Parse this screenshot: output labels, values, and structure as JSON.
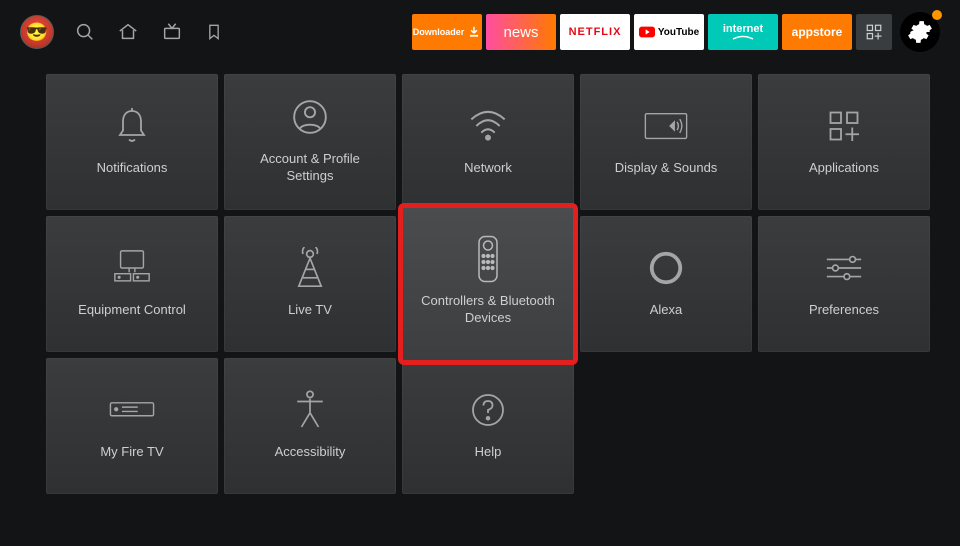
{
  "nav": {
    "search": "search",
    "home": "home",
    "live": "live",
    "bookmark": "bookmark"
  },
  "apps": {
    "downloader": "Downloader",
    "news": "news",
    "netflix": "NETFLIX",
    "youtube": "YouTube",
    "internet": "internet",
    "appstore": "appstore"
  },
  "tiles": [
    {
      "label": "Notifications",
      "icon": "bell"
    },
    {
      "label": "Account & Profile Settings",
      "icon": "profile"
    },
    {
      "label": "Network",
      "icon": "wifi"
    },
    {
      "label": "Display & Sounds",
      "icon": "display-sound"
    },
    {
      "label": "Applications",
      "icon": "apps"
    },
    {
      "label": "Equipment Control",
      "icon": "equipment"
    },
    {
      "label": "Live TV",
      "icon": "antenna"
    },
    {
      "label": "Controllers & Bluetooth Devices",
      "icon": "remote",
      "highlighted": true
    },
    {
      "label": "Alexa",
      "icon": "alexa"
    },
    {
      "label": "Preferences",
      "icon": "sliders"
    },
    {
      "label": "My Fire TV",
      "icon": "firetv"
    },
    {
      "label": "Accessibility",
      "icon": "accessibility"
    },
    {
      "label": "Help",
      "icon": "help"
    }
  ]
}
